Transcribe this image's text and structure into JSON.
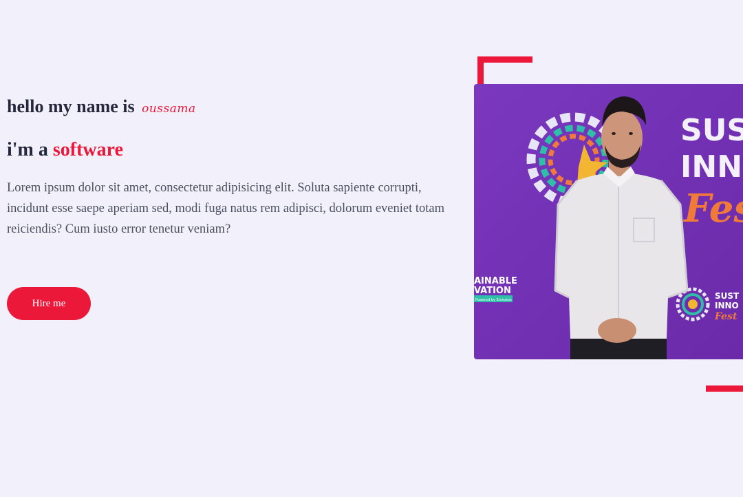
{
  "hero": {
    "greeting_prefix": "hello my name is",
    "name": "oussama",
    "role_prefix": "i'm a",
    "role_word": "software",
    "description": "Lorem ipsum dolor sit amet, consectetur adipisicing elit. Soluta sapiente corrupti, incidunt esse saepe aperiam sed, modi fuga natus rem adipisci, dolorum eveniet totam reiciendis? Cum iusto error tenetur veniam?",
    "hire_button_label": "Hire me"
  },
  "photo": {
    "banner_text_line1": "SUS",
    "banner_text_line2": "INN",
    "banner_text_line3": "Fes",
    "banner_small_line1": "AINABLE",
    "banner_small_line2": "VATION",
    "banner_tiny": "Powered by Emirates",
    "banner_small_right1": "SUST",
    "banner_small_right2": "INNO",
    "banner_small_right3": "Fest"
  },
  "colors": {
    "accent": "#ec1839",
    "text_dark": "#25283d",
    "text_body": "#4b4e5f",
    "background": "#f2f1fb",
    "banner_purple": "#7b35b8"
  }
}
